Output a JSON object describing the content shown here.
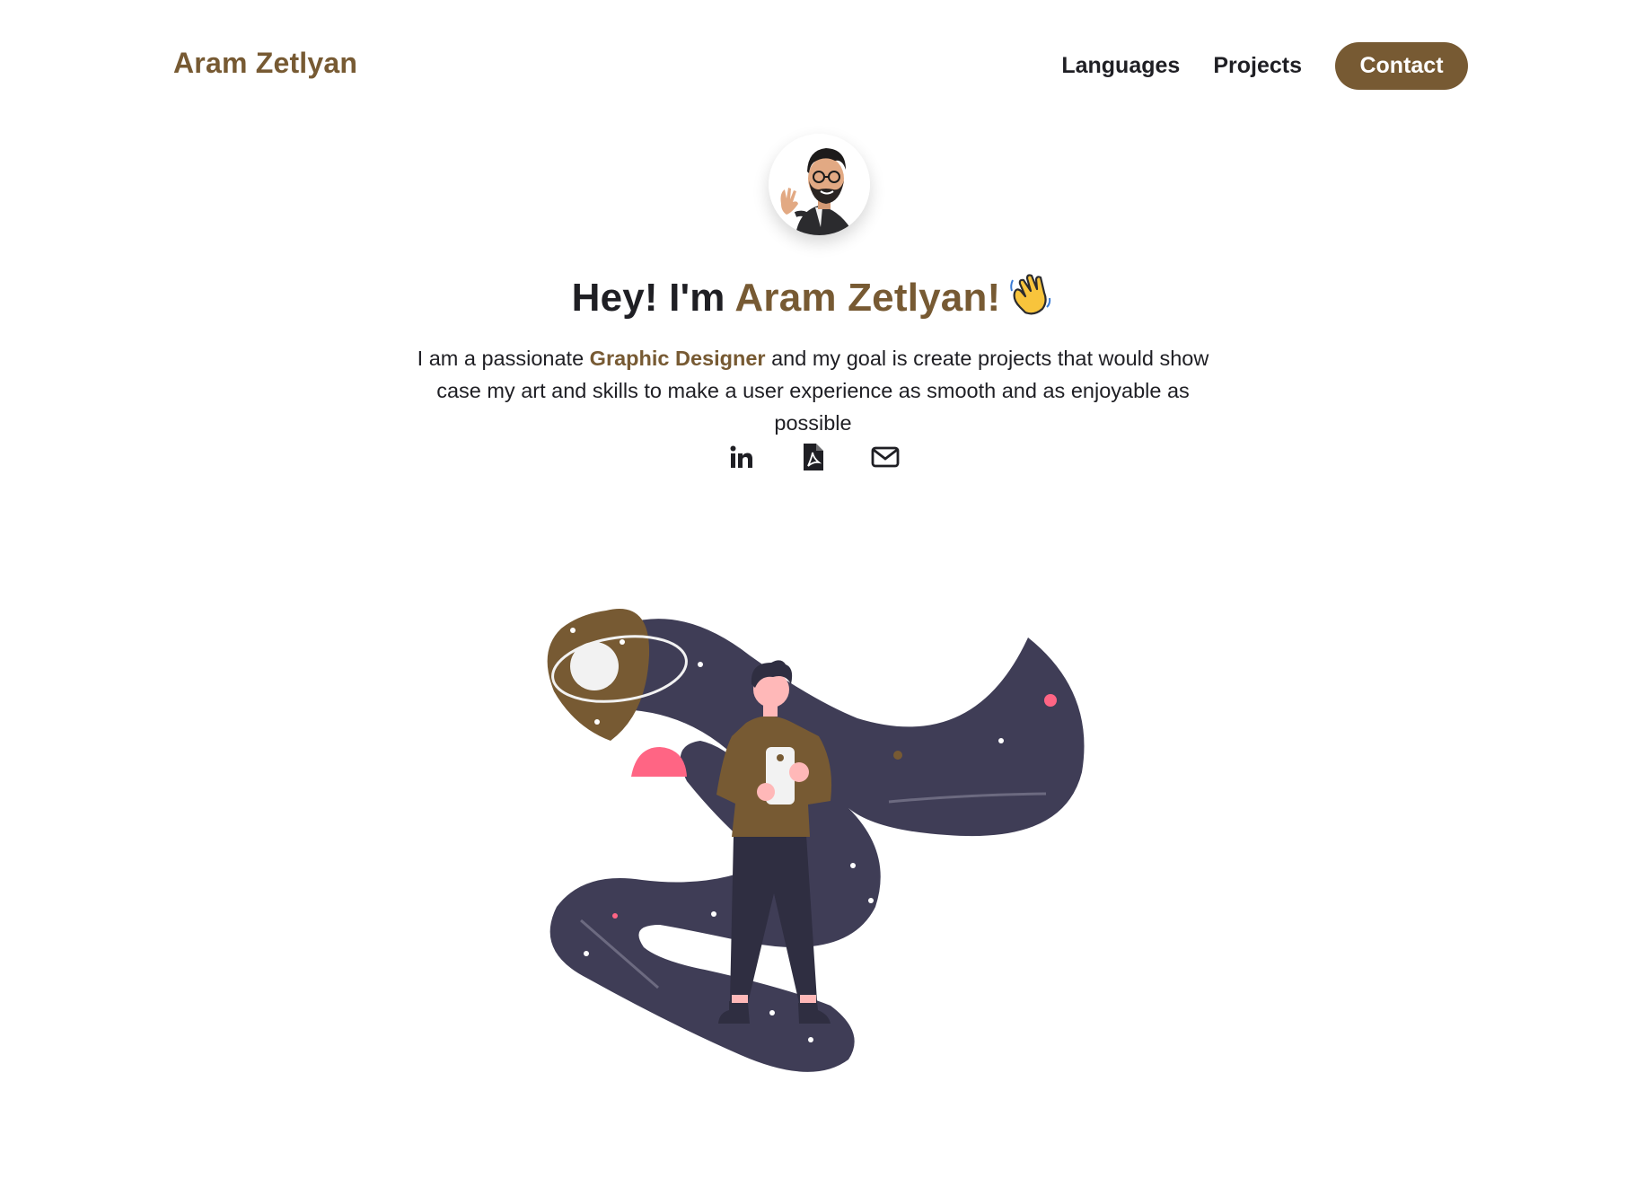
{
  "header": {
    "brand": "Aram Zetlyan",
    "nav": {
      "languages": "Languages",
      "projects": "Projects",
      "contact": "Contact"
    }
  },
  "hero": {
    "headline_prefix": "Hey! I'm ",
    "headline_name": "Aram Zetlyan!",
    "intro_before": "I am a passionate ",
    "intro_role": "Graphic Designer",
    "intro_after": " and my goal is create projects that would show case my art and skills to make a user experience as smooth and as enjoyable as possible"
  },
  "socials": [
    {
      "name": "linkedin-icon"
    },
    {
      "name": "pdf-resume-icon"
    },
    {
      "name": "email-icon"
    }
  ],
  "colors": {
    "accent": "#775a33",
    "text": "#1f1f24",
    "illustration_dark": "#3f3d56",
    "pink": "#ff6584"
  }
}
